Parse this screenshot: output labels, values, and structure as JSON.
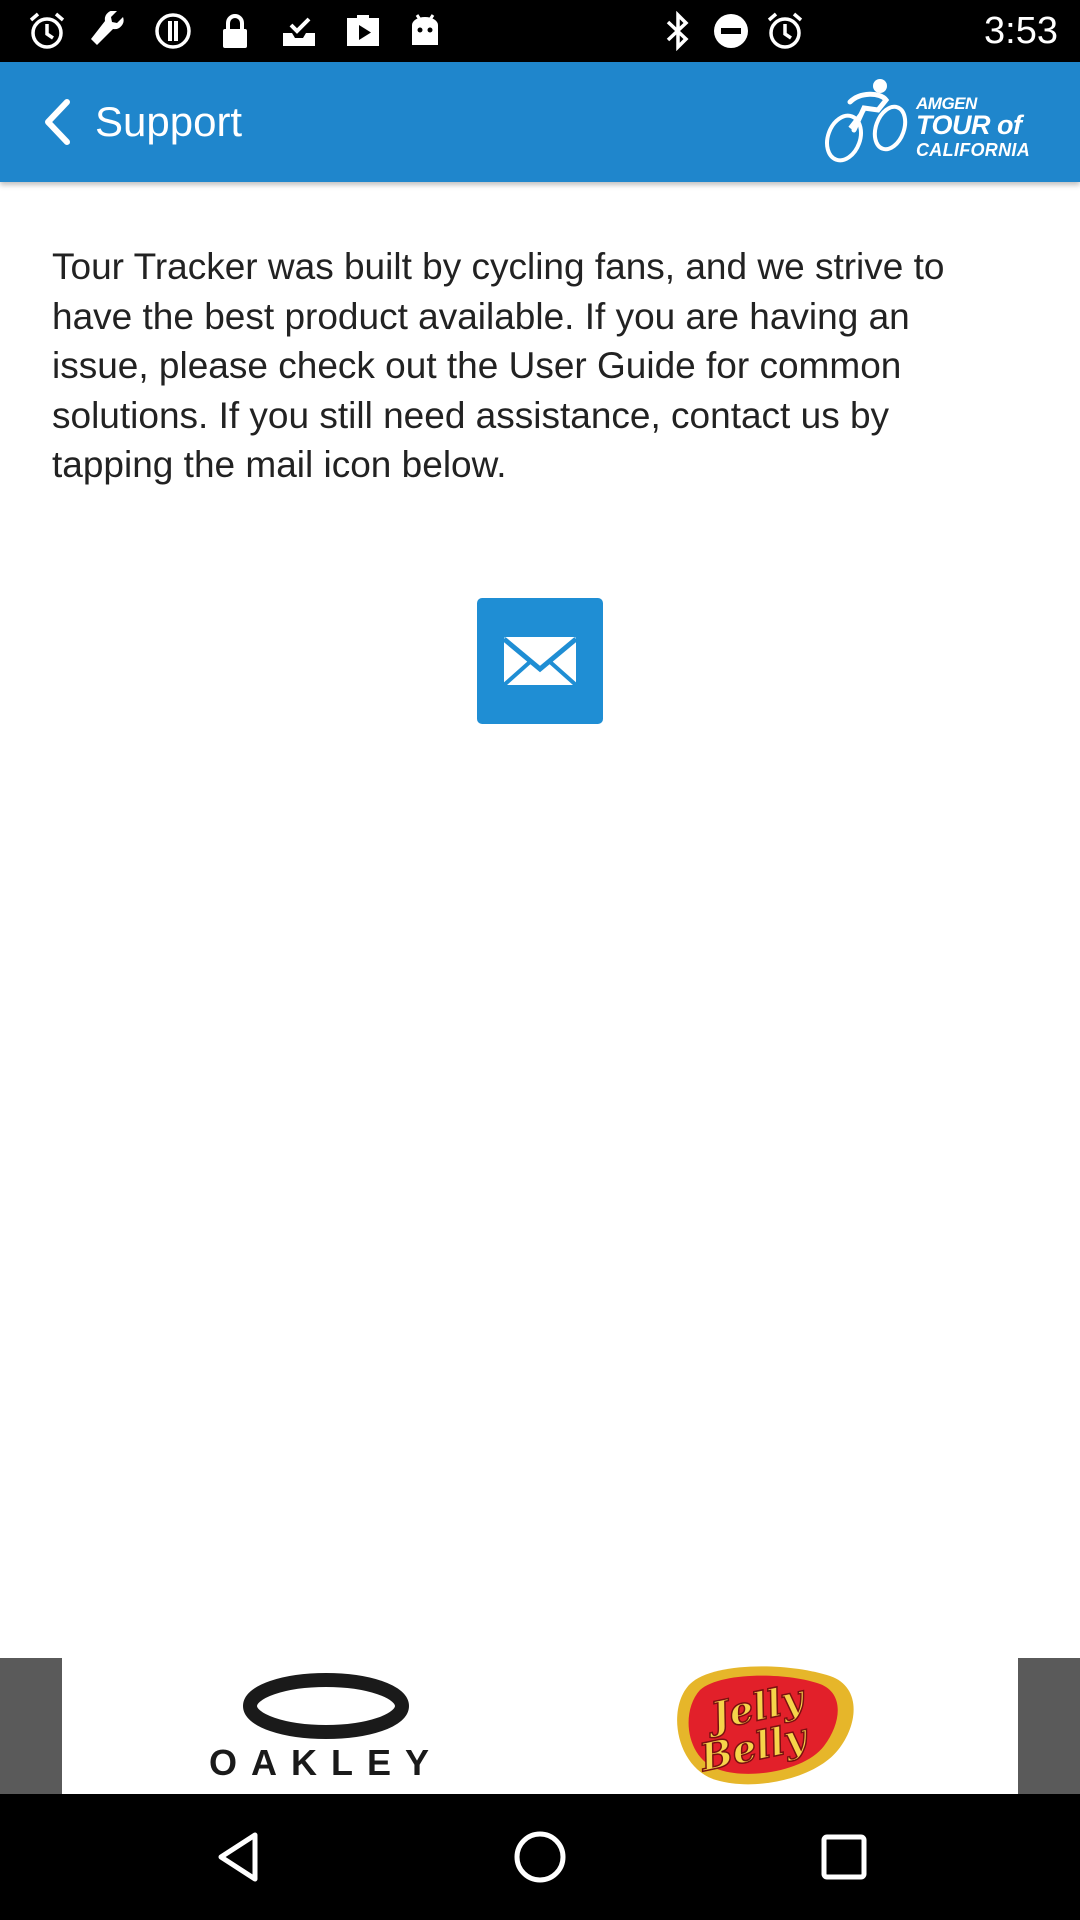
{
  "status_bar": {
    "time": "3:53",
    "icons": [
      "alarm-icon",
      "wrench-icon",
      "info-icon",
      "lock-icon",
      "inbox-icon",
      "play-store-icon",
      "android-icon",
      "bluetooth-icon",
      "do-not-disturb-icon",
      "alarm-icon"
    ]
  },
  "app_bar": {
    "title": "Support",
    "logo_lines": [
      "AMGEN",
      "TOUR of",
      "CALIFORNIA"
    ],
    "color": "#1f86cc"
  },
  "content": {
    "paragraph": "Tour Tracker was built by cycling fans, and we strive to have the best product available. If you are having an issue, please check out the User Guide for common solutions. If you still need assistance, contact us by tapping the mail icon below.",
    "mail_icon": "mail-icon",
    "mail_button_color": "#1f8ed4"
  },
  "sponsors": {
    "oakley": "OAKLEY",
    "jelly_belly_line1": "Jelly",
    "jelly_belly_line2": "Belly"
  },
  "nav_bar": {
    "buttons": [
      "back-triangle-icon",
      "home-circle-icon",
      "recents-square-icon"
    ]
  }
}
